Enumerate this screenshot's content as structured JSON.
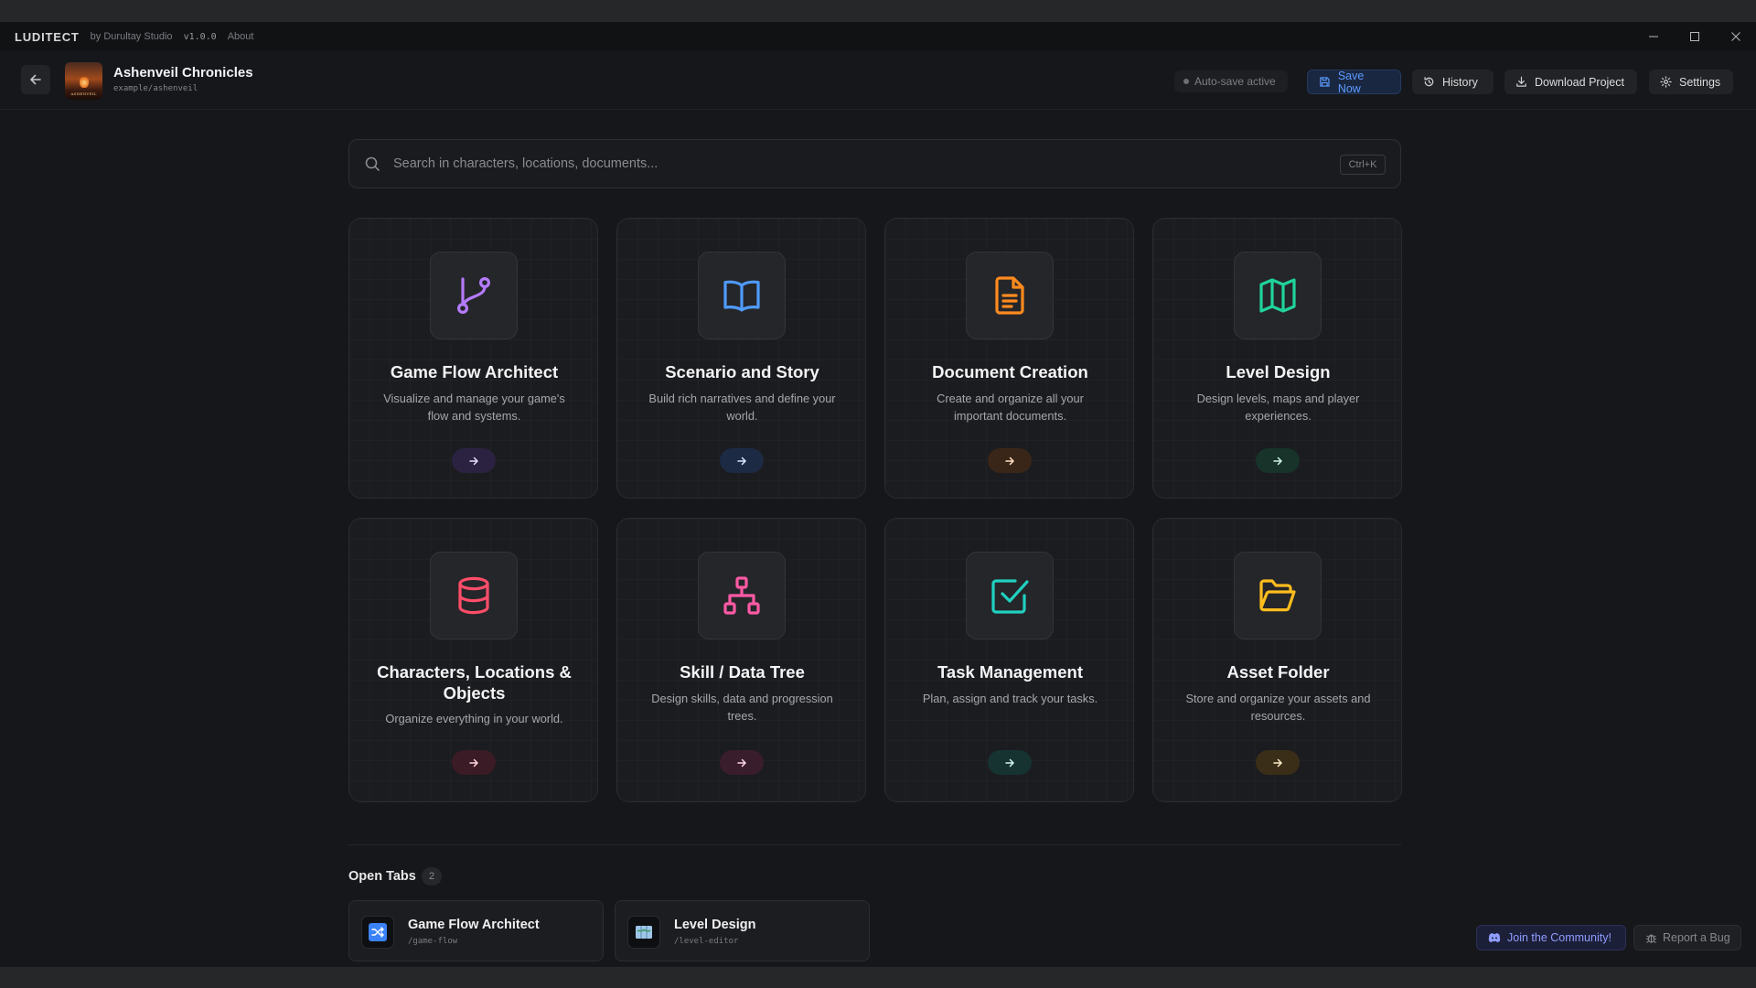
{
  "titlebar": {
    "app_name": "LUDITECT",
    "by": "by Durultay Studio",
    "version": "v1.0.0",
    "about": "About"
  },
  "project": {
    "title": "Ashenveil Chronicles",
    "path": "example/ashenveil",
    "thumb_text": "ASHENVEIL"
  },
  "header": {
    "autosave": "Auto-save active",
    "save": "Save Now",
    "history": "History",
    "download": "Download Project",
    "settings": "Settings"
  },
  "search": {
    "placeholder": "Search in characters, locations, documents...",
    "shortcut": "Ctrl+K"
  },
  "cards": [
    {
      "title": "Game Flow Architect",
      "desc": "Visualize and manage your game's flow and systems.",
      "color": "#b57bff",
      "arrow_bg": "#2a2240",
      "icon": "git-branch-icon"
    },
    {
      "title": "Scenario and Story",
      "desc": "Build rich narratives and define your world.",
      "color": "#4f9bff",
      "arrow_bg": "#1d2a44",
      "icon": "open-book-icon"
    },
    {
      "title": "Document Creation",
      "desc": "Create and organize all your important documents.",
      "color": "#ff8a1e",
      "arrow_bg": "#3a2618",
      "icon": "document-icon"
    },
    {
      "title": "Level Design",
      "desc": "Design levels, maps and player experiences.",
      "color": "#20d39a",
      "arrow_bg": "#17332a",
      "icon": "map-icon"
    },
    {
      "title": "Characters, Locations & Objects",
      "desc": "Organize everything in your world.",
      "color": "#ff4d6a",
      "arrow_bg": "#3b1b25",
      "icon": "database-icon"
    },
    {
      "title": "Skill / Data Tree",
      "desc": "Design skills, data and progression trees.",
      "color": "#ff5aa5",
      "arrow_bg": "#3a1d2c",
      "icon": "hierarchy-icon"
    },
    {
      "title": "Task Management",
      "desc": "Plan, assign and track your tasks.",
      "color": "#20d0c0",
      "arrow_bg": "#163332",
      "icon": "checkbox-icon"
    },
    {
      "title": "Asset Folder",
      "desc": "Store and organize your assets and resources.",
      "color": "#ffbd1e",
      "arrow_bg": "#3a2e18",
      "icon": "folder-open-icon"
    }
  ],
  "open_tabs": {
    "label": "Open Tabs",
    "count": "2",
    "tabs": [
      {
        "name": "Game Flow Architect",
        "path": "/game-flow"
      },
      {
        "name": "Level Design",
        "path": "/level-editor"
      }
    ]
  },
  "footer": {
    "community": "Join the Community!",
    "bug": "Report a Bug"
  }
}
